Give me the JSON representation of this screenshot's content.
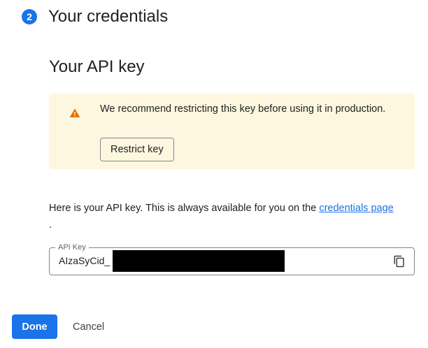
{
  "step": {
    "number": "2",
    "title": "Your credentials"
  },
  "section": {
    "title": "Your API key"
  },
  "warning": {
    "icon": "warning-triangle-icon",
    "message": "We recommend restricting this key before using it in production.",
    "restrict_label": "Restrict key",
    "background_color": "#fef7e0",
    "icon_color": "#e37400"
  },
  "info": {
    "text_before": "Here is your API key. This is always available for you on the ",
    "link_text": "credentials page",
    "text_after": "."
  },
  "api_key_field": {
    "label": "API Key",
    "value": "AIzaSyCid_",
    "copy_icon": "copy-icon"
  },
  "actions": {
    "done_label": "Done",
    "cancel_label": "Cancel"
  },
  "colors": {
    "accent": "#1a73e8",
    "text": "#202124"
  }
}
